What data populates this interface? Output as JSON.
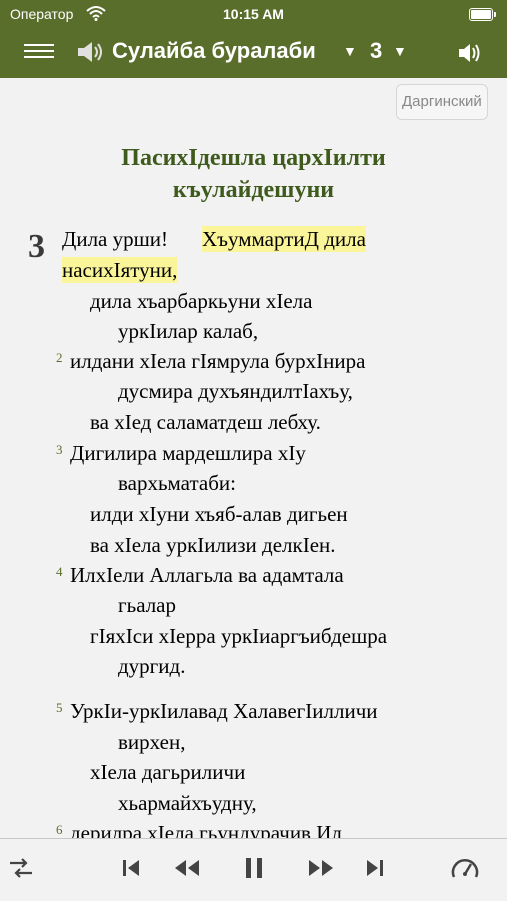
{
  "status": {
    "carrier": "Оператор",
    "time": "10:15 AM"
  },
  "header": {
    "book_title": "Сулайба буралаби",
    "chapter": "3"
  },
  "language_button": "Даргинский",
  "heading": [
    "ПасихIдешла цархIилти",
    "къулайдешуни"
  ],
  "chapter_number": "3",
  "lines": [
    {
      "id": "l1a",
      "text": "Дила урши!"
    },
    {
      "id": "l1b",
      "text": "ХъуммартиД дила"
    },
    {
      "id": "l2",
      "text": "насихIятуни,"
    },
    {
      "id": "l3",
      "text": "дила хъарбаркьуни хIела"
    },
    {
      "id": "l4",
      "text": "уркIилар калаб,"
    },
    {
      "id": "l5",
      "text": "илдани хIела гIямрула бурхIнира"
    },
    {
      "id": "l6",
      "text": "дусмира духъяндилтIахъу,"
    },
    {
      "id": "l7",
      "text": "ва хIед саламатдеш лебху."
    },
    {
      "id": "l8",
      "text": "Дигилира мардешлира хIу"
    },
    {
      "id": "l9",
      "text": "вархьматаби:"
    },
    {
      "id": "l10",
      "text": "илди хIуни хъяб-алав дигьен"
    },
    {
      "id": "l11",
      "text": "ва хIела уркIилизи делкIен."
    },
    {
      "id": "l12",
      "text": "ИлхIели Аллагьла ва адамтала"
    },
    {
      "id": "l13",
      "text": "гьалар"
    },
    {
      "id": "l14",
      "text": "гIяхIси хIерра уркIиаргъибдешра"
    },
    {
      "id": "l15",
      "text": "дургид."
    },
    {
      "id": "l16",
      "text": "УркIи-уркIилавад ХалавегIилличи"
    },
    {
      "id": "l17",
      "text": "вирхен,"
    },
    {
      "id": "l18",
      "text": "хIела дагьриличи"
    },
    {
      "id": "l19",
      "text": "хьармайхъудну,"
    },
    {
      "id": "l20",
      "text": "дерилра хIела гьундурачив Ил"
    }
  ],
  "verse_numbers": {
    "v2": "2",
    "v3": "3",
    "v4": "4",
    "v5": "5",
    "v6": "6"
  },
  "colors": {
    "header": "#5a6e2c",
    "highlight": "#fbf59a",
    "heading_text": "#3e5a1c"
  },
  "icons": [
    "wifi-icon",
    "battery-icon",
    "menu-icon",
    "speaker-icon",
    "caret-down-icon",
    "volume-icon",
    "shuffle-icon",
    "skip-back-icon",
    "rewind-icon",
    "pause-icon",
    "fast-forward-icon",
    "skip-forward-icon",
    "speedometer-icon"
  ]
}
